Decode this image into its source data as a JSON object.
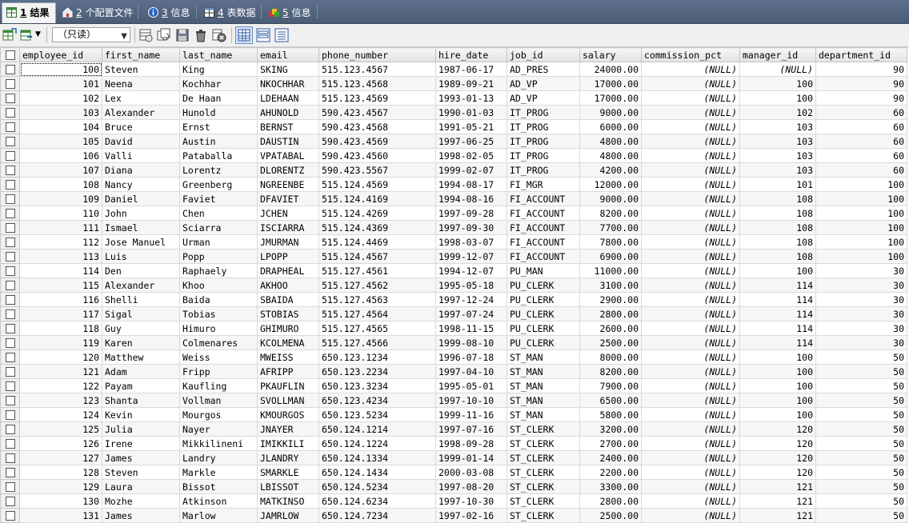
{
  "tabs": [
    {
      "num": "1",
      "label": "结果",
      "icon": "grid-icon",
      "active": true
    },
    {
      "num": "2",
      "label": "个配置文件",
      "icon": "profile-icon",
      "active": false
    },
    {
      "num": "3",
      "label": "信息",
      "icon": "info-icon",
      "active": false
    },
    {
      "num": "4",
      "label": "表数据",
      "icon": "table-icon",
      "active": false
    },
    {
      "num": "5",
      "label": "信息",
      "icon": "info-multi-icon",
      "active": false
    }
  ],
  "toolbar": {
    "mode_select": "（只读）",
    "buttons": [
      "export-icon",
      "import-icon",
      "add-row-icon",
      "duplicate-row-icon",
      "save-icon",
      "delete-row-icon",
      "cancel-icon",
      "grid-view-icon",
      "form-view-icon",
      "text-view-icon"
    ]
  },
  "grid": {
    "columns": [
      "employee_id",
      "first_name",
      "last_name",
      "email",
      "phone_number",
      "hire_date",
      "job_id",
      "salary",
      "commission_pct",
      "manager_id",
      "department_id"
    ],
    "rows": [
      [
        "100",
        "Steven",
        "King",
        "SKING",
        "515.123.4567",
        "1987-06-17",
        "AD_PRES",
        "24000.00",
        "(NULL)",
        "(NULL)",
        "90"
      ],
      [
        "101",
        "Neena",
        "Kochhar",
        "NKOCHHAR",
        "515.123.4568",
        "1989-09-21",
        "AD_VP",
        "17000.00",
        "(NULL)",
        "100",
        "90"
      ],
      [
        "102",
        "Lex",
        "De Haan",
        "LDEHAAN",
        "515.123.4569",
        "1993-01-13",
        "AD_VP",
        "17000.00",
        "(NULL)",
        "100",
        "90"
      ],
      [
        "103",
        "Alexander",
        "Hunold",
        "AHUNOLD",
        "590.423.4567",
        "1990-01-03",
        "IT_PROG",
        "9000.00",
        "(NULL)",
        "102",
        "60"
      ],
      [
        "104",
        "Bruce",
        "Ernst",
        "BERNST",
        "590.423.4568",
        "1991-05-21",
        "IT_PROG",
        "6000.00",
        "(NULL)",
        "103",
        "60"
      ],
      [
        "105",
        "David",
        "Austin",
        "DAUSTIN",
        "590.423.4569",
        "1997-06-25",
        "IT_PROG",
        "4800.00",
        "(NULL)",
        "103",
        "60"
      ],
      [
        "106",
        "Valli",
        "Pataballa",
        "VPATABAL",
        "590.423.4560",
        "1998-02-05",
        "IT_PROG",
        "4800.00",
        "(NULL)",
        "103",
        "60"
      ],
      [
        "107",
        "Diana",
        "Lorentz",
        "DLORENTZ",
        "590.423.5567",
        "1999-02-07",
        "IT_PROG",
        "4200.00",
        "(NULL)",
        "103",
        "60"
      ],
      [
        "108",
        "Nancy",
        "Greenberg",
        "NGREENBE",
        "515.124.4569",
        "1994-08-17",
        "FI_MGR",
        "12000.00",
        "(NULL)",
        "101",
        "100"
      ],
      [
        "109",
        "Daniel",
        "Faviet",
        "DFAVIET",
        "515.124.4169",
        "1994-08-16",
        "FI_ACCOUNT",
        "9000.00",
        "(NULL)",
        "108",
        "100"
      ],
      [
        "110",
        "John",
        "Chen",
        "JCHEN",
        "515.124.4269",
        "1997-09-28",
        "FI_ACCOUNT",
        "8200.00",
        "(NULL)",
        "108",
        "100"
      ],
      [
        "111",
        "Ismael",
        "Sciarra",
        "ISCIARRA",
        "515.124.4369",
        "1997-09-30",
        "FI_ACCOUNT",
        "7700.00",
        "(NULL)",
        "108",
        "100"
      ],
      [
        "112",
        "Jose Manuel",
        "Urman",
        "JMURMAN",
        "515.124.4469",
        "1998-03-07",
        "FI_ACCOUNT",
        "7800.00",
        "(NULL)",
        "108",
        "100"
      ],
      [
        "113",
        "Luis",
        "Popp",
        "LPOPP",
        "515.124.4567",
        "1999-12-07",
        "FI_ACCOUNT",
        "6900.00",
        "(NULL)",
        "108",
        "100"
      ],
      [
        "114",
        "Den",
        "Raphaely",
        "DRAPHEAL",
        "515.127.4561",
        "1994-12-07",
        "PU_MAN",
        "11000.00",
        "(NULL)",
        "100",
        "30"
      ],
      [
        "115",
        "Alexander",
        "Khoo",
        "AKHOO",
        "515.127.4562",
        "1995-05-18",
        "PU_CLERK",
        "3100.00",
        "(NULL)",
        "114",
        "30"
      ],
      [
        "116",
        "Shelli",
        "Baida",
        "SBAIDA",
        "515.127.4563",
        "1997-12-24",
        "PU_CLERK",
        "2900.00",
        "(NULL)",
        "114",
        "30"
      ],
      [
        "117",
        "Sigal",
        "Tobias",
        "STOBIAS",
        "515.127.4564",
        "1997-07-24",
        "PU_CLERK",
        "2800.00",
        "(NULL)",
        "114",
        "30"
      ],
      [
        "118",
        "Guy",
        "Himuro",
        "GHIMURO",
        "515.127.4565",
        "1998-11-15",
        "PU_CLERK",
        "2600.00",
        "(NULL)",
        "114",
        "30"
      ],
      [
        "119",
        "Karen",
        "Colmenares",
        "KCOLMENA",
        "515.127.4566",
        "1999-08-10",
        "PU_CLERK",
        "2500.00",
        "(NULL)",
        "114",
        "30"
      ],
      [
        "120",
        "Matthew",
        "Weiss",
        "MWEISS",
        "650.123.1234",
        "1996-07-18",
        "ST_MAN",
        "8000.00",
        "(NULL)",
        "100",
        "50"
      ],
      [
        "121",
        "Adam",
        "Fripp",
        "AFRIPP",
        "650.123.2234",
        "1997-04-10",
        "ST_MAN",
        "8200.00",
        "(NULL)",
        "100",
        "50"
      ],
      [
        "122",
        "Payam",
        "Kaufling",
        "PKAUFLIN",
        "650.123.3234",
        "1995-05-01",
        "ST_MAN",
        "7900.00",
        "(NULL)",
        "100",
        "50"
      ],
      [
        "123",
        "Shanta",
        "Vollman",
        "SVOLLMAN",
        "650.123.4234",
        "1997-10-10",
        "ST_MAN",
        "6500.00",
        "(NULL)",
        "100",
        "50"
      ],
      [
        "124",
        "Kevin",
        "Mourgos",
        "KMOURGOS",
        "650.123.5234",
        "1999-11-16",
        "ST_MAN",
        "5800.00",
        "(NULL)",
        "100",
        "50"
      ],
      [
        "125",
        "Julia",
        "Nayer",
        "JNAYER",
        "650.124.1214",
        "1997-07-16",
        "ST_CLERK",
        "3200.00",
        "(NULL)",
        "120",
        "50"
      ],
      [
        "126",
        "Irene",
        "Mikkilineni",
        "IMIKKILI",
        "650.124.1224",
        "1998-09-28",
        "ST_CLERK",
        "2700.00",
        "(NULL)",
        "120",
        "50"
      ],
      [
        "127",
        "James",
        "Landry",
        "JLANDRY",
        "650.124.1334",
        "1999-01-14",
        "ST_CLERK",
        "2400.00",
        "(NULL)",
        "120",
        "50"
      ],
      [
        "128",
        "Steven",
        "Markle",
        "SMARKLE",
        "650.124.1434",
        "2000-03-08",
        "ST_CLERK",
        "2200.00",
        "(NULL)",
        "120",
        "50"
      ],
      [
        "129",
        "Laura",
        "Bissot",
        "LBISSOT",
        "650.124.5234",
        "1997-08-20",
        "ST_CLERK",
        "3300.00",
        "(NULL)",
        "121",
        "50"
      ],
      [
        "130",
        "Mozhe",
        "Atkinson",
        "MATKINSO",
        "650.124.6234",
        "1997-10-30",
        "ST_CLERK",
        "2800.00",
        "(NULL)",
        "121",
        "50"
      ],
      [
        "131",
        "James",
        "Marlow",
        "JAMRLOW",
        "650.124.7234",
        "1997-02-16",
        "ST_CLERK",
        "2500.00",
        "(NULL)",
        "121",
        "50"
      ]
    ]
  }
}
